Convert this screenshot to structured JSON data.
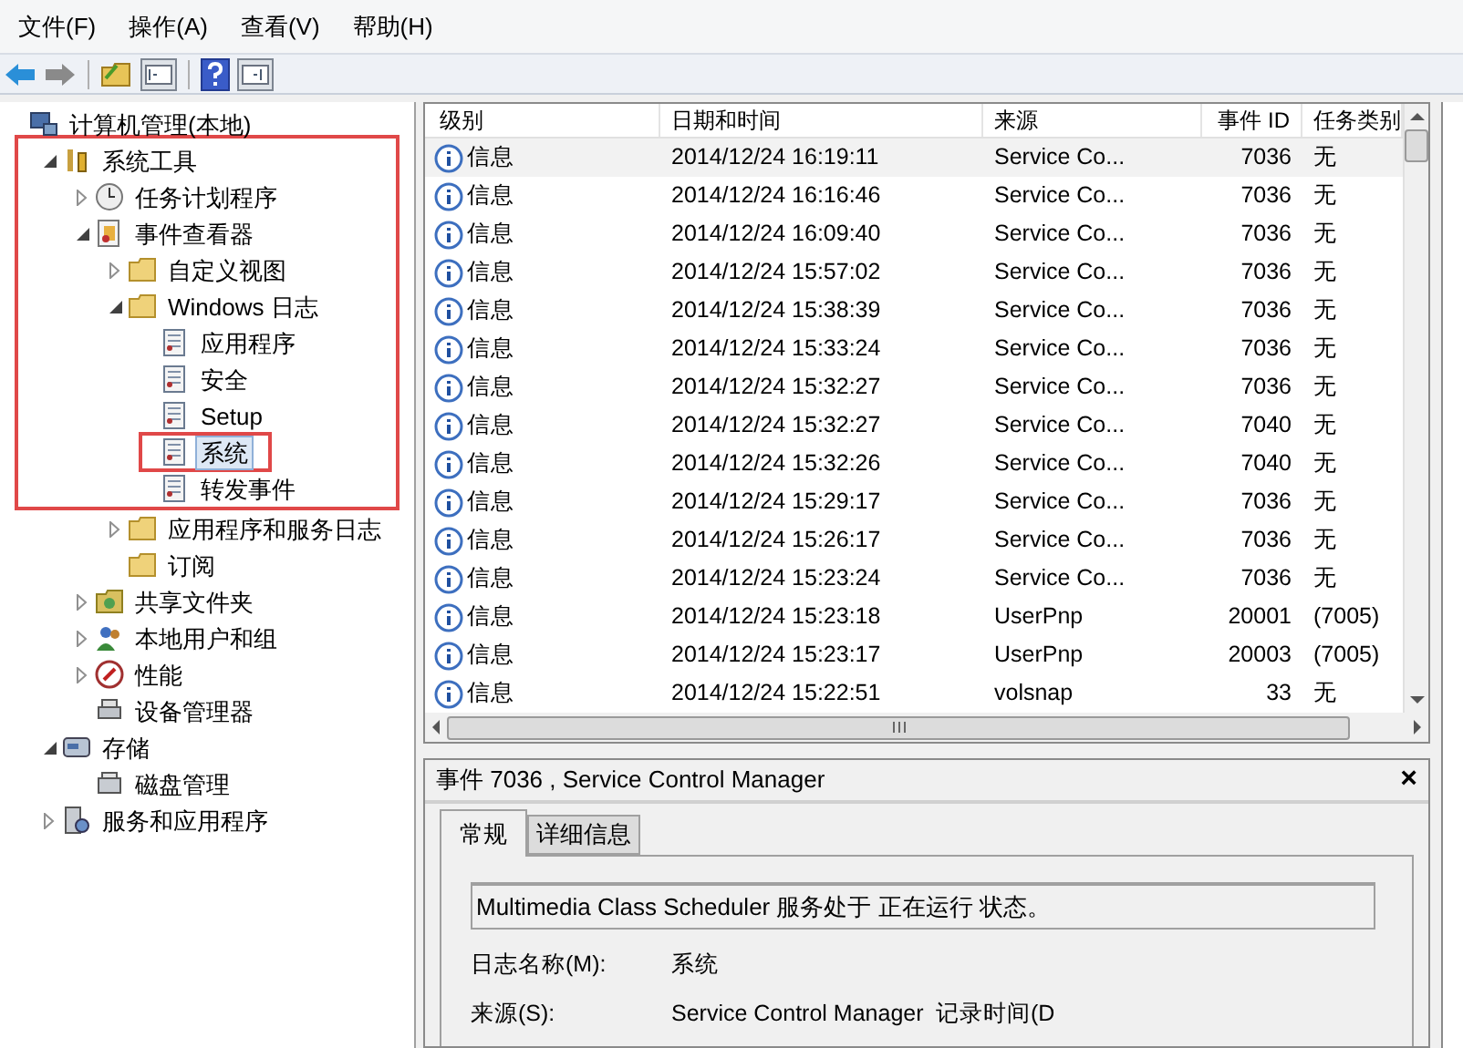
{
  "menu": [
    "文件(F)",
    "操作(A)",
    "查看(V)",
    "帮助(H)"
  ],
  "tree": [
    {
      "label": "计算机管理(本地)",
      "kind": "computer",
      "children": [
        {
          "label": "系统工具",
          "kind": "tools",
          "expanded": true,
          "outline_start": true,
          "children": [
            {
              "label": "任务计划程序",
              "kind": "clock",
              "expanded": false
            },
            {
              "label": "事件查看器",
              "kind": "viewer",
              "expanded": true,
              "children": [
                {
                  "label": "自定义视图",
                  "kind": "folder",
                  "expanded": false
                },
                {
                  "label": "Windows 日志",
                  "kind": "folder",
                  "expanded": true,
                  "children": [
                    {
                      "label": "应用程序",
                      "kind": "log",
                      "selected": false
                    },
                    {
                      "label": "安全",
                      "kind": "log",
                      "selected": false
                    },
                    {
                      "label": "Setup",
                      "kind": "log",
                      "selected": false
                    },
                    {
                      "label": "系统",
                      "kind": "log",
                      "selected": true,
                      "outlined": true
                    },
                    {
                      "label": "转发事件",
                      "kind": "log",
                      "selected": false,
                      "outline_end": true
                    }
                  ]
                },
                {
                  "label": "应用程序和服务日志",
                  "kind": "folder",
                  "expanded": false
                },
                {
                  "label": "订阅",
                  "kind": "folder"
                }
              ]
            },
            {
              "label": "共享文件夹",
              "kind": "share",
              "expanded": false
            },
            {
              "label": "本地用户和组",
              "kind": "users",
              "expanded": false
            },
            {
              "label": "性能",
              "kind": "perf",
              "expanded": false
            },
            {
              "label": "设备管理器",
              "kind": "device"
            }
          ]
        },
        {
          "label": "存储",
          "kind": "storage",
          "expanded": true,
          "children": [
            {
              "label": "磁盘管理",
              "kind": "disk"
            }
          ]
        },
        {
          "label": "服务和应用程序",
          "kind": "services",
          "expanded": false
        }
      ]
    }
  ],
  "table": {
    "columns": [
      "级别",
      "日期和时间",
      "来源",
      "事件 ID",
      "任务类别"
    ],
    "rows": [
      [
        "信息",
        "2014/12/24 16:19:11",
        "Service Co...",
        "7036",
        "无"
      ],
      [
        "信息",
        "2014/12/24 16:16:46",
        "Service Co...",
        "7036",
        "无"
      ],
      [
        "信息",
        "2014/12/24 16:09:40",
        "Service Co...",
        "7036",
        "无"
      ],
      [
        "信息",
        "2014/12/24 15:57:02",
        "Service Co...",
        "7036",
        "无"
      ],
      [
        "信息",
        "2014/12/24 15:38:39",
        "Service Co...",
        "7036",
        "无"
      ],
      [
        "信息",
        "2014/12/24 15:33:24",
        "Service Co...",
        "7036",
        "无"
      ],
      [
        "信息",
        "2014/12/24 15:32:27",
        "Service Co...",
        "7036",
        "无"
      ],
      [
        "信息",
        "2014/12/24 15:32:27",
        "Service Co...",
        "7040",
        "无"
      ],
      [
        "信息",
        "2014/12/24 15:32:26",
        "Service Co...",
        "7040",
        "无"
      ],
      [
        "信息",
        "2014/12/24 15:29:17",
        "Service Co...",
        "7036",
        "无"
      ],
      [
        "信息",
        "2014/12/24 15:26:17",
        "Service Co...",
        "7036",
        "无"
      ],
      [
        "信息",
        "2014/12/24 15:23:24",
        "Service Co...",
        "7036",
        "无"
      ],
      [
        "信息",
        "2014/12/24 15:23:18",
        "UserPnp",
        "20001",
        "(7005)"
      ],
      [
        "信息",
        "2014/12/24 15:23:17",
        "UserPnp",
        "20003",
        "(7005)"
      ],
      [
        "信息",
        "2014/12/24 15:22:51",
        "volsnap",
        "33",
        "无"
      ]
    ]
  },
  "details": {
    "title": "事件 7036 , Service Control Manager",
    "close": "×",
    "tabs": [
      {
        "label": "常规",
        "selected": true
      },
      {
        "label": "详细信息",
        "selected": false
      }
    ],
    "description": "Multimedia Class Scheduler 服务处于 正在运行 状态。",
    "fields": [
      {
        "label": "日志名称(M):",
        "value": "系统"
      },
      {
        "label": "来源(S):",
        "value": "Service Control Manager",
        "extra": "记录时间(D"
      }
    ]
  }
}
